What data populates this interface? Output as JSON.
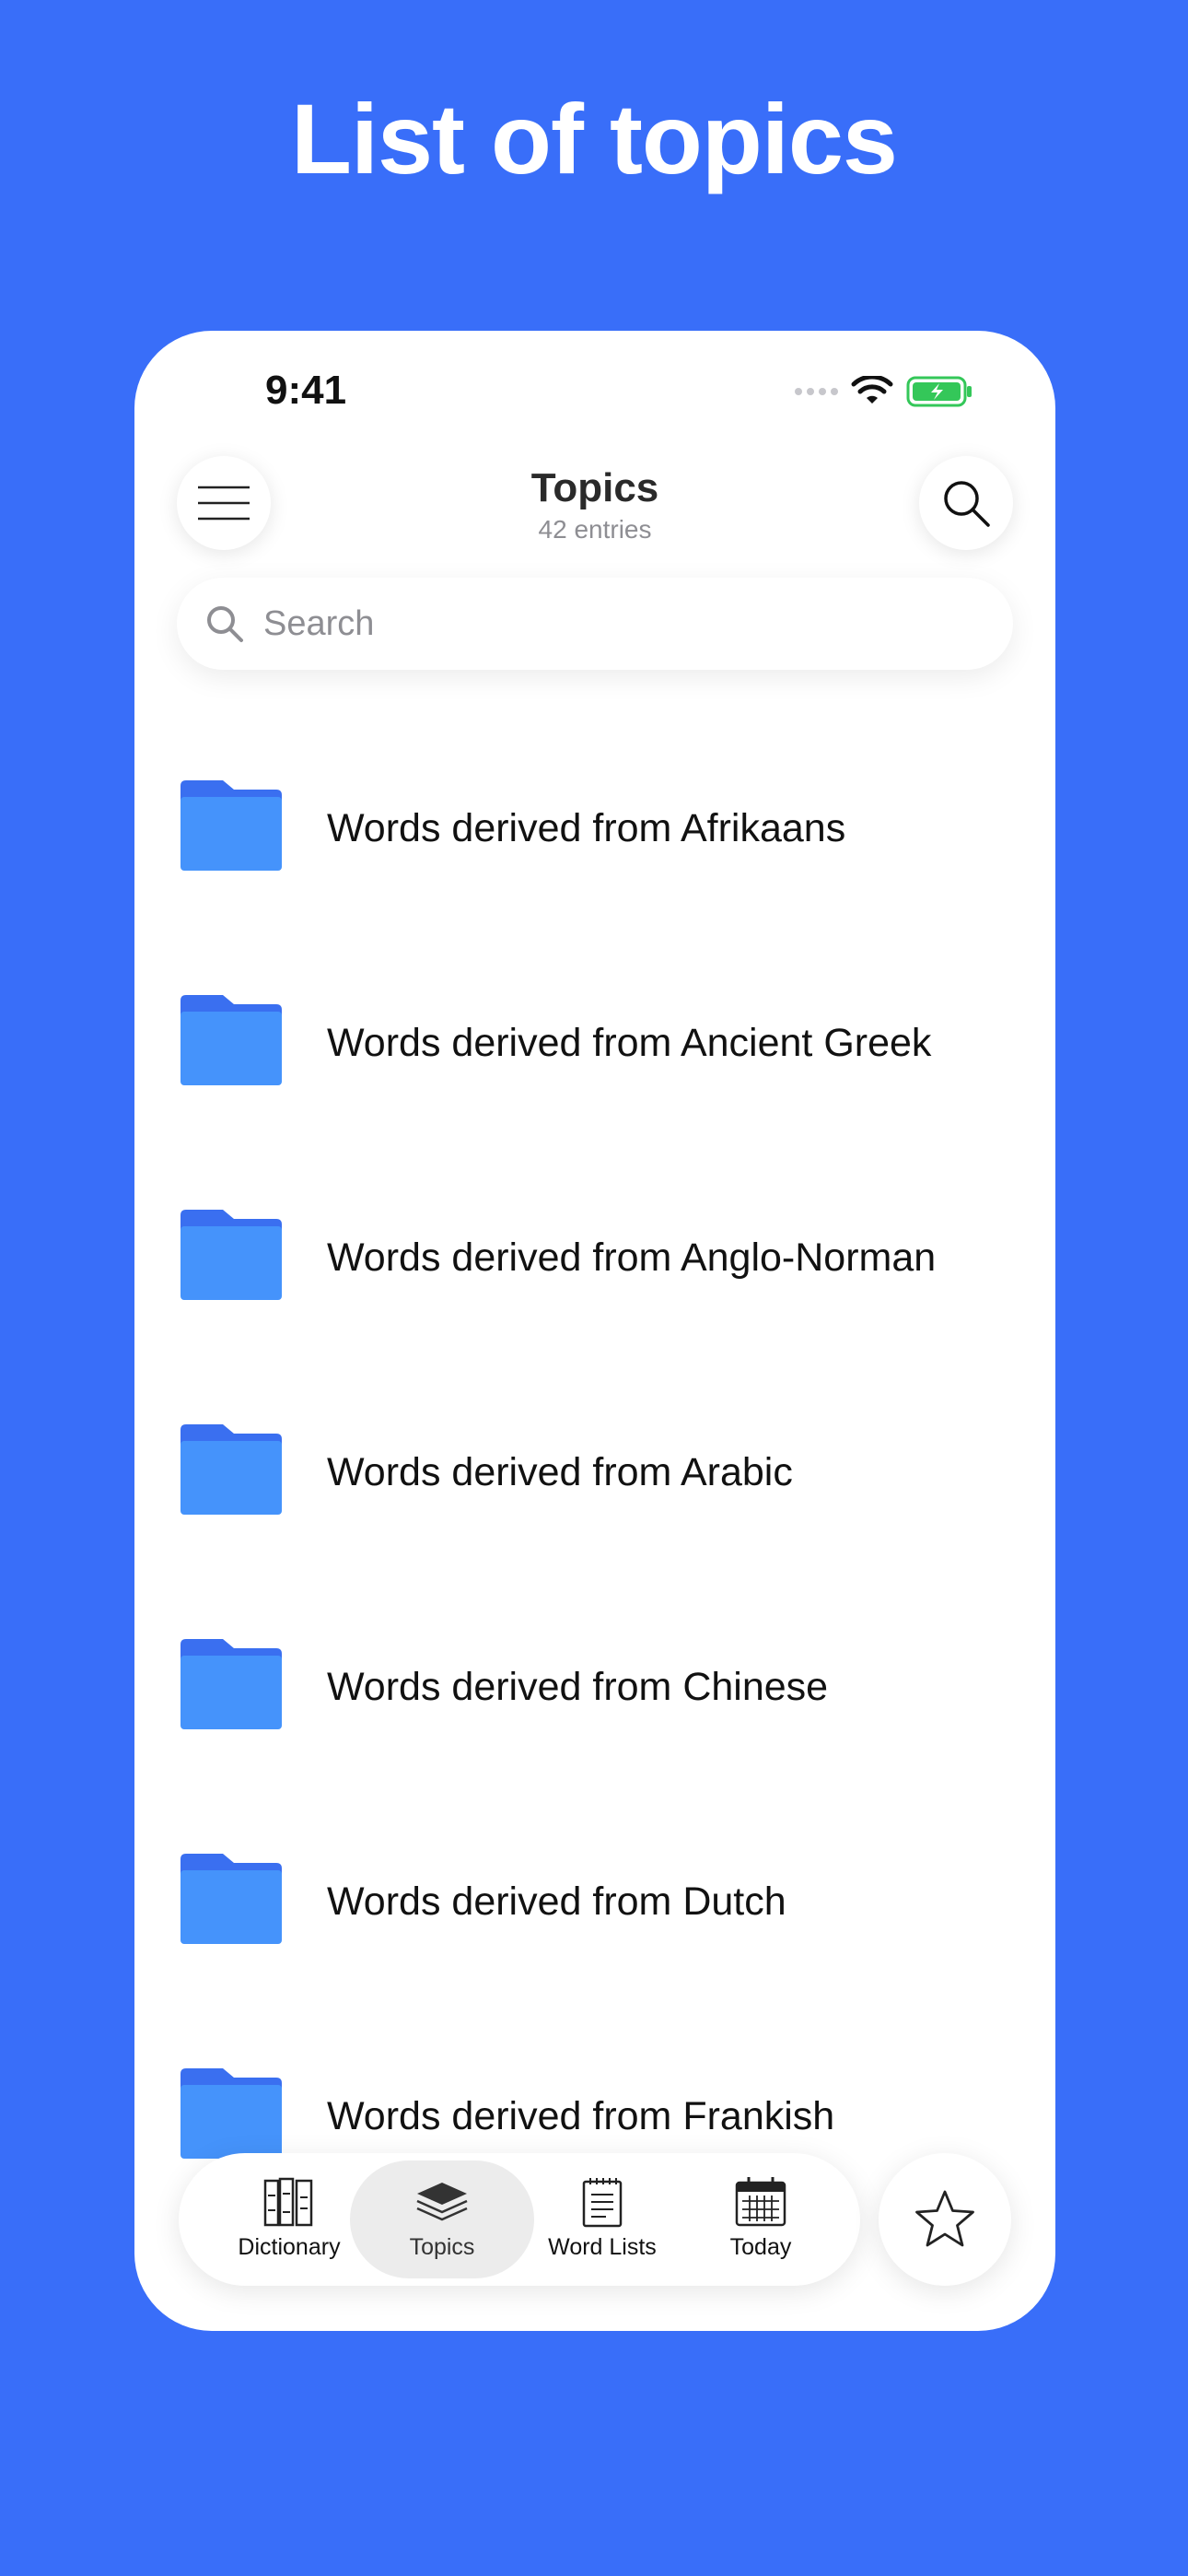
{
  "headline": "List of topics",
  "status_bar": {
    "time": "9:41"
  },
  "nav": {
    "title": "Topics",
    "subtitle": "42 entries"
  },
  "search": {
    "placeholder": "Search"
  },
  "topics": [
    {
      "label": "Words derived from Afrikaans"
    },
    {
      "label": "Words derived from Ancient Greek"
    },
    {
      "label": "Words derived from Anglo-Norman"
    },
    {
      "label": "Words derived from Arabic"
    },
    {
      "label": "Words derived from Chinese"
    },
    {
      "label": "Words derived from Dutch"
    },
    {
      "label": "Words derived from Frankish"
    }
  ],
  "tab_bar": {
    "tabs": [
      {
        "label": "Dictionary",
        "icon": "books-icon",
        "active": false
      },
      {
        "label": "Topics",
        "icon": "layers-icon",
        "active": true
      },
      {
        "label": "Word Lists",
        "icon": "notepad-icon",
        "active": false
      },
      {
        "label": "Today",
        "icon": "calendar-icon",
        "active": false
      }
    ],
    "favorites_icon": "star-icon"
  },
  "colors": {
    "background": "#396ef9",
    "folder_front": "#4593fb",
    "folder_back": "#3a6ff0",
    "battery": "#34c759"
  }
}
